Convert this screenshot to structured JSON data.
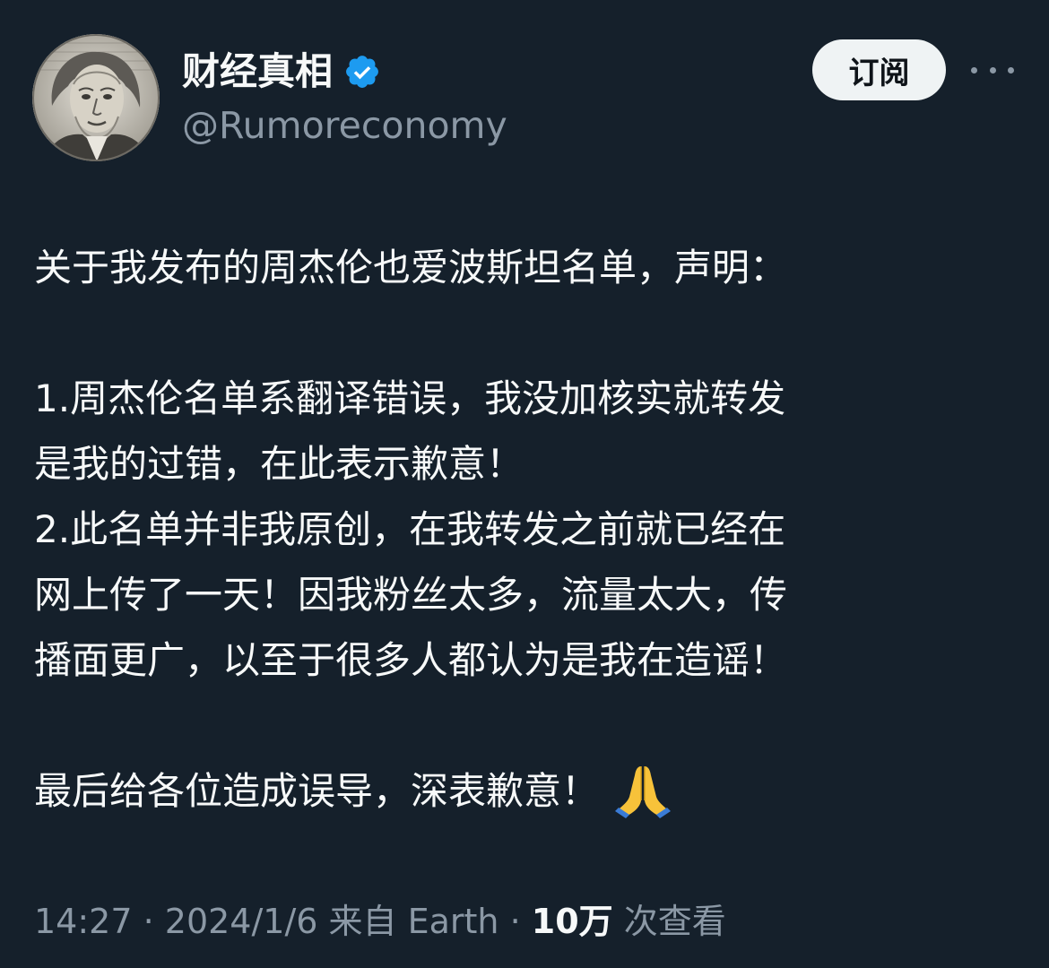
{
  "author": {
    "display_name": "财经真相",
    "handle": "@Rumoreconomy",
    "avatar_icon": "portrait-avatar",
    "verified_icon": "verified-badge-icon",
    "verified_color": "#1d9bf0"
  },
  "actions": {
    "subscribe_label": "订阅",
    "more_icon": "more-options-icon"
  },
  "tweet": {
    "lines": [
      "关于我发布的周杰伦也爱波斯坦名单，声明：",
      "",
      "1.周杰伦名单系翻译错误，我没加核实就转发",
      "是我的过错，在此表示歉意！",
      "2.此名单并非我原创，在我转发之前就已经在",
      "网上传了一天！因我粉丝太多，流量太大，传",
      "播面更广，以至于很多人都认为是我在造谣！",
      "",
      "最后给各位造成误导，深表歉意！"
    ],
    "trailing_emoji": "🙏"
  },
  "meta": {
    "time": "14:27",
    "separator": " · ",
    "date": "2024/1/6",
    "source": "来自 Earth",
    "views_count": "10万",
    "views_label": "次查看"
  },
  "colors": {
    "background": "#15202b",
    "text_primary": "#f7f9f9",
    "text_secondary": "#8b98a5",
    "button_bg": "#eff3f4"
  }
}
